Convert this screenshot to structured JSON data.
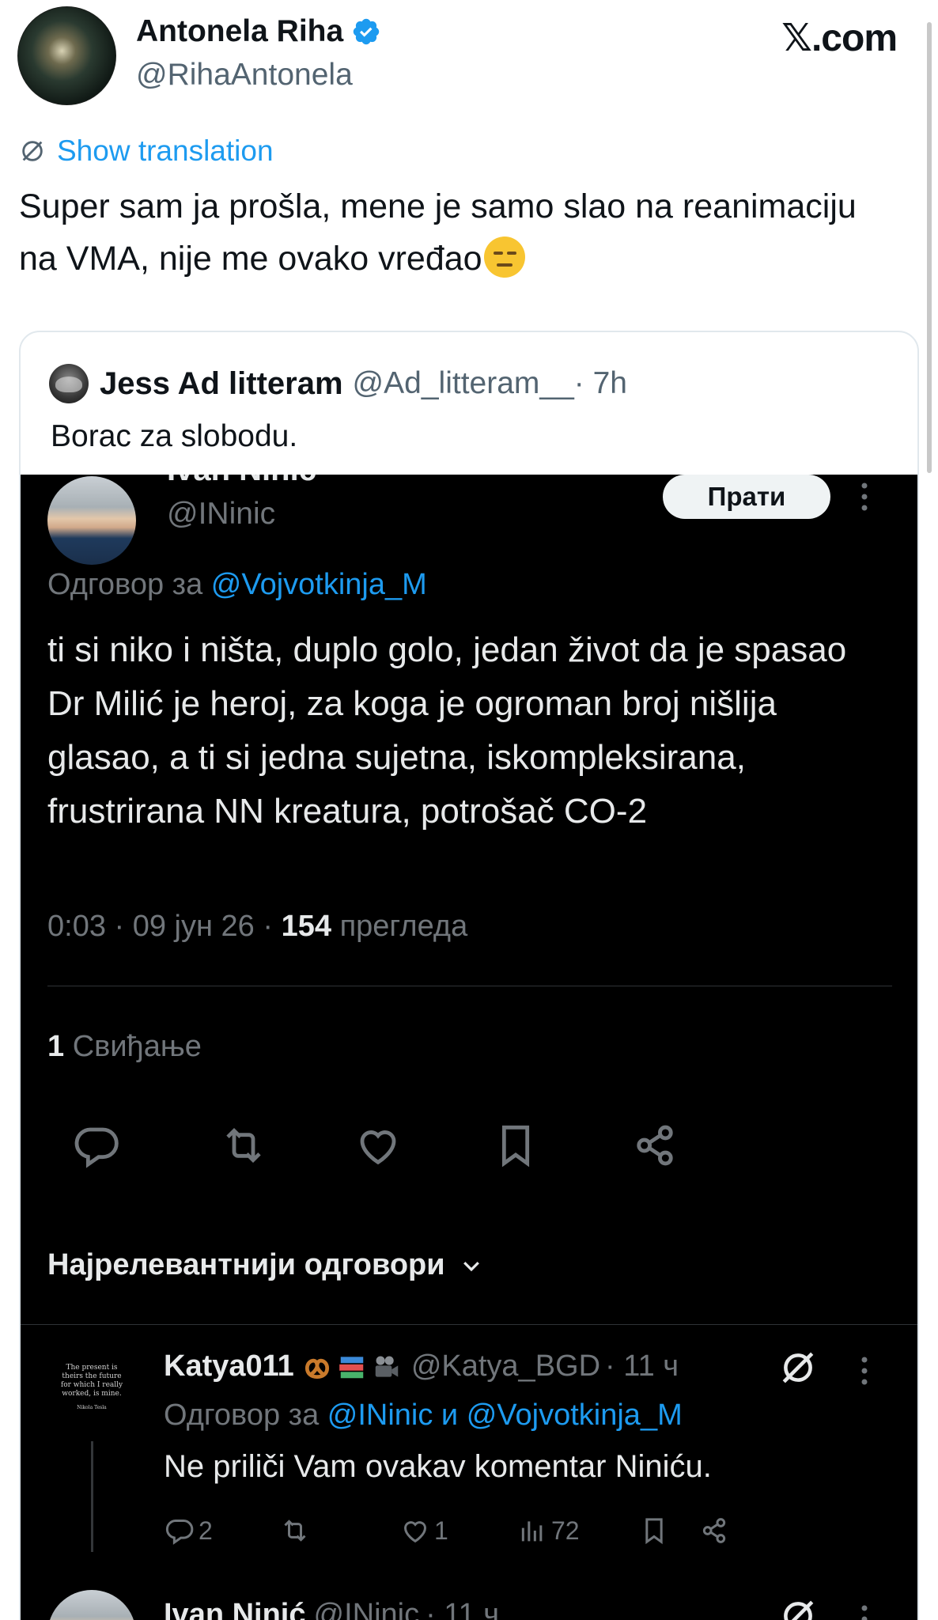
{
  "author": {
    "name": "Antonela Riha",
    "handle": "@RihaAntonela",
    "verified": true
  },
  "site_label": ".com",
  "show_translation": "Show translation",
  "tweet_text": "Super sam ja prošla, mene je samo slao na reanimaciju na VMA, nije me ovako vređao",
  "tweet_emoji": "expressionless-face",
  "quote": {
    "name": "Jess Ad litteram",
    "handle": "@Ad_litteram__",
    "time": "· 7h",
    "text": "Borac za slobodu."
  },
  "embedded": {
    "name_cut": "Ivan Ninić",
    "handle": "@INinic",
    "follow_label": "Прати",
    "reply_prefix": "Одговор за",
    "reply_mention": "@Vojvotkinja_M",
    "text": "ti si niko i ništa, duplo golo, jedan život da je spasao Dr Milić je heroj, za koga je ogroman broj nišlija glasao, a ti si jedna sujetna, iskompleksirana, frustrirana NN kreatura, potrošač CO-2",
    "meta_time": "0:03 · 09 јун 26 ·",
    "meta_views_count": "154",
    "meta_views_label": "прегледа",
    "likes_count": "1",
    "likes_label": "Свиђање",
    "sort_label": "Најрелевантнији одговори",
    "actions": [
      "reply-icon",
      "repost-icon",
      "like-icon",
      "bookmark-icon",
      "share-icon"
    ]
  },
  "reply1": {
    "avatar_text": "The present is theirs the future for which I really worked, is mine.",
    "avatar_sig": "Nikola Tesla",
    "name": "Katya011",
    "emojis": [
      "pretzel-icon",
      "books-icon",
      "movie-camera-icon"
    ],
    "handle": "@Katya_BGD",
    "time": "· 11 ч",
    "reply_prefix": "Одговор за",
    "reply_mentions": "@INinic и @Vojvotkinja_M",
    "text": "Ne priliči Vam ovakav komentar Niniću.",
    "replies": "2",
    "likes": "1",
    "views": "72"
  },
  "reply2": {
    "name": "Ivan Ninić",
    "handle": "@INinic",
    "time": "· 11 ч"
  },
  "colors": {
    "accent": "#1d9bf0",
    "dark_bg": "#000000",
    "muted": "#71767b",
    "text_dark": "#e7e9ea"
  }
}
